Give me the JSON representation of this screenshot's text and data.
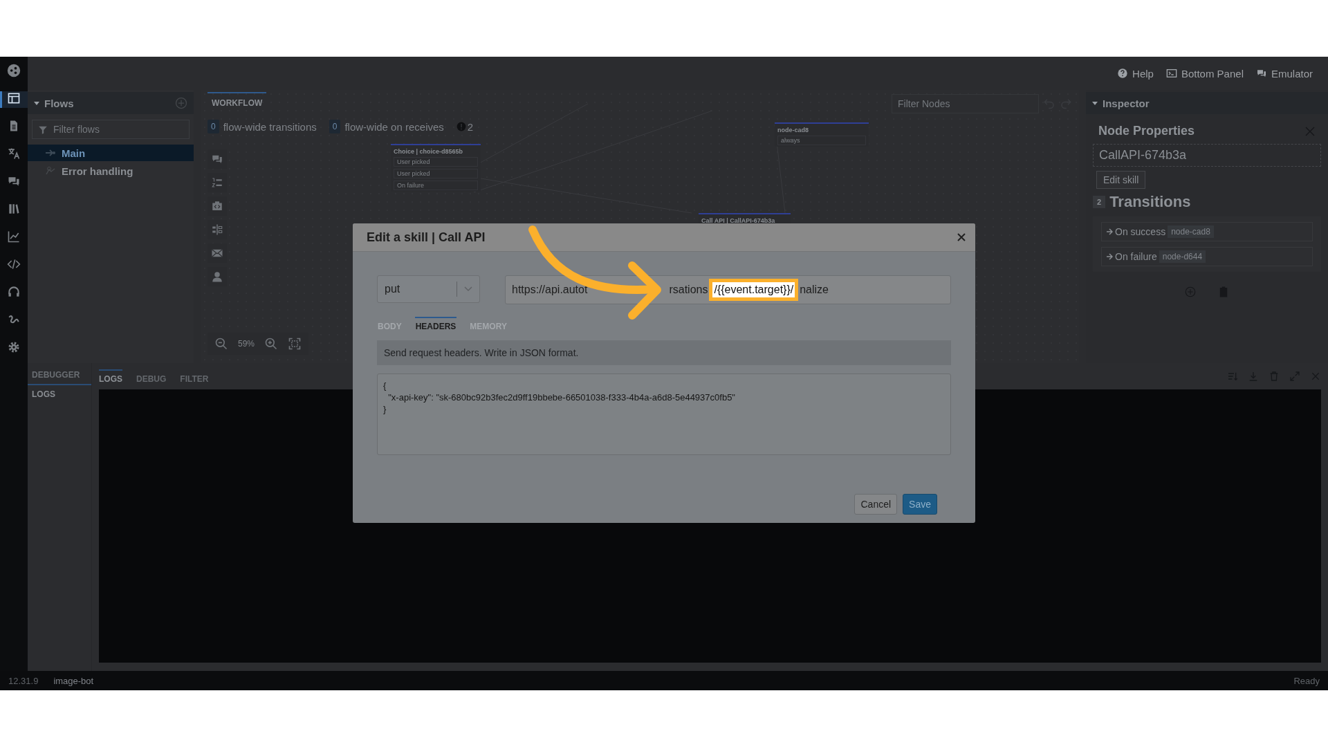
{
  "rail": [
    {
      "kind": "share",
      "selected": false
    },
    {
      "kind": "layout",
      "selected": true
    },
    {
      "kind": "document",
      "selected": false
    },
    {
      "kind": "translate",
      "selected": false
    },
    {
      "kind": "chat",
      "selected": false
    },
    {
      "kind": "library",
      "selected": false
    },
    {
      "kind": "chart",
      "selected": false
    },
    {
      "kind": "code",
      "selected": false
    },
    {
      "kind": "headset",
      "selected": false
    },
    {
      "kind": "flow",
      "selected": false
    },
    {
      "kind": "gear",
      "selected": false
    }
  ],
  "header": {
    "links": [
      {
        "kind": "help",
        "label": "Help"
      },
      {
        "kind": "terminal",
        "label": "Bottom Panel"
      },
      {
        "kind": "chat",
        "label": "Emulator"
      }
    ]
  },
  "flows": {
    "title": "Flows",
    "filter": {
      "placeholder": "Filter flows"
    },
    "items": [
      {
        "kind": "entry",
        "label": "Main",
        "selected": true
      },
      {
        "kind": "error",
        "label": "Error handling",
        "selected": false
      }
    ]
  },
  "workflow": {
    "tab": "WORKFLOW",
    "counters": [
      {
        "count": "0",
        "label": "flow-wide transitions"
      },
      {
        "count": "0",
        "label": "flow-wide on receives"
      }
    ],
    "warnings": "2",
    "filter": {
      "placeholder": "Filter Nodes"
    },
    "tools": [
      {
        "kind": "chat"
      },
      {
        "kind": "list"
      },
      {
        "kind": "camera"
      },
      {
        "kind": "split"
      },
      {
        "kind": "mail"
      },
      {
        "kind": "person"
      }
    ],
    "zoom": "59%",
    "nodes": [
      {
        "title": "Choice | choice-d8565b",
        "rows": [
          "User picked",
          "User picked",
          "On failure"
        ]
      },
      {
        "title": "node-cad8",
        "rows": [
          "always"
        ]
      },
      {
        "title": "Call API | CallAPI-674b3a"
      }
    ]
  },
  "inspector": {
    "title": "Inspector",
    "heading": "Node Properties",
    "node_name": "CallAPI-674b3a",
    "edit_button": "Edit skill",
    "transitions_count": "2",
    "transitions_title": "Transitions",
    "transitions": [
      {
        "label": "On success",
        "target": "node-cad8"
      },
      {
        "label": "On failure",
        "target": "node-d644"
      }
    ]
  },
  "bottom_panel": {
    "side_tab": "DEBUGGER",
    "side_item": "LOGS",
    "tabs": [
      {
        "label": "LOGS",
        "selected": true
      },
      {
        "label": "DEBUG",
        "selected": false
      },
      {
        "label": "FILTER",
        "selected": false
      }
    ]
  },
  "status_bar": {
    "version": "12.31.9",
    "bot": "image-bot",
    "status": "Ready"
  },
  "modal": {
    "title": "Edit a skill | Call API",
    "method": "put",
    "url_parts": [
      {
        "text": "https://api.autot",
        "highlighted": false
      },
      {
        "text": "rsations",
        "highlighted": false
      },
      {
        "text": "/{{event.target}}/",
        "highlighted": true
      },
      {
        "text": "nalize",
        "highlighted": false
      }
    ],
    "tabs": [
      {
        "label": "BODY",
        "selected": false
      },
      {
        "label": "HEADERS",
        "selected": true
      },
      {
        "label": "MEMORY",
        "selected": false
      }
    ],
    "hint": "Send request headers. Write in JSON format.",
    "headers_lines": [
      "{",
      "  \"x-api-key\": \"sk-680bc92b3fec2d9ff19bbebe-66501038-f333-4b4a-a6d8-5e44937c0fb5\"",
      "}"
    ],
    "buttons": [
      {
        "kind": "secondary",
        "label": "Cancel"
      },
      {
        "kind": "primary",
        "label": "Save"
      }
    ]
  }
}
